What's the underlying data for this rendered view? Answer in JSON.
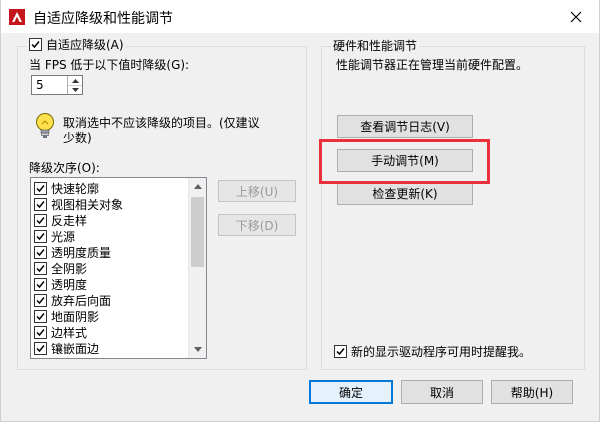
{
  "window": {
    "title": "自适应降级和性能调节",
    "accent_color": "#e8313a"
  },
  "adaptive": {
    "group_label": "自适应降级(A)",
    "checked": true,
    "fps_label": "当 FPS 低于以下值时降级(G):",
    "fps_value": "5",
    "hint": "取消选中不应该降级的项目。(仅建议",
    "hint_line2": "少数)",
    "order_label": "降级次序(O):",
    "items": [
      {
        "label": "快速轮廓",
        "checked": true
      },
      {
        "label": "视图相关对象",
        "checked": true
      },
      {
        "label": "反走样",
        "checked": true
      },
      {
        "label": "光源",
        "checked": true
      },
      {
        "label": "透明度质量",
        "checked": true
      },
      {
        "label": "全阴影",
        "checked": true
      },
      {
        "label": "透明度",
        "checked": true
      },
      {
        "label": "放弃后向面",
        "checked": true
      },
      {
        "label": "地面阴影",
        "checked": true
      },
      {
        "label": "边样式",
        "checked": true
      },
      {
        "label": "镶嵌面边",
        "checked": true
      }
    ],
    "move_up": "上移(U)",
    "move_down": "下移(D)"
  },
  "hardware": {
    "group_label": "硬件和性能调节",
    "description": "性能调节器正在管理当前硬件配置。",
    "view_log": "查看调节日志(V)",
    "manual_tune": "手动调节(M)",
    "check_updates": "检查更新(K)",
    "notify_label": "新的显示驱动程序可用时提醒我。",
    "notify_checked": true
  },
  "footer": {
    "ok": "确定",
    "cancel": "取消",
    "help": "帮助(H)"
  }
}
